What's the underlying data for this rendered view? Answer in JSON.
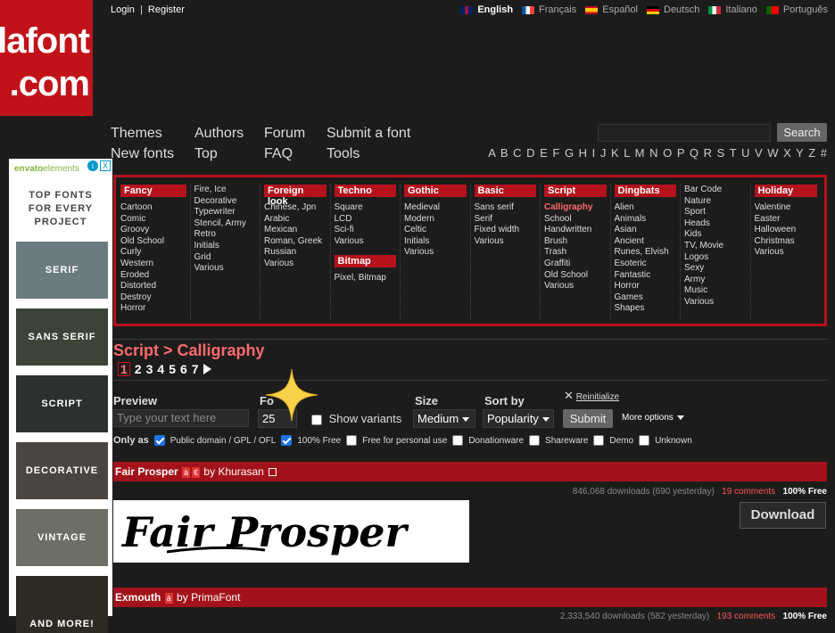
{
  "logo": {
    "line1": "lafont",
    "line2": ".com"
  },
  "topbar": {
    "login": "Login",
    "sep": "|",
    "register": "Register"
  },
  "languages": [
    {
      "label": "English",
      "active": true,
      "colors": [
        "#012169",
        "#c8102e"
      ]
    },
    {
      "label": "Français",
      "active": false,
      "colors": [
        "#0055a4",
        "#ef4135"
      ]
    },
    {
      "label": "Español",
      "active": false,
      "colors": [
        "#c60b1e",
        "#ffc400"
      ]
    },
    {
      "label": "Deutsch",
      "active": false,
      "colors": [
        "#000000",
        "#dd0000"
      ]
    },
    {
      "label": "Italiano",
      "active": false,
      "colors": [
        "#009246",
        "#ce2b37"
      ]
    },
    {
      "label": "Português",
      "active": false,
      "colors": [
        "#006600",
        "#ff0000"
      ]
    }
  ],
  "nav": {
    "themes": "Themes",
    "authors": "Authors",
    "forum": "Forum",
    "submit": "Submit a font",
    "new_fonts": "New fonts",
    "top": "Top",
    "faq": "FAQ",
    "tools": "Tools"
  },
  "search": {
    "button": "Search"
  },
  "alphabet": "A B C D E F G H I J K L M N O P Q R S T U V W X Y Z #",
  "ad": {
    "brand_a": "envato",
    "brand_b": "elements",
    "headline": "TOP FONTS FOR EVERY PROJECT",
    "tiles": [
      "SERIF",
      "SANS SERIF",
      "SCRIPT",
      "DECORATIVE",
      "VINTAGE",
      "AND MORE!"
    ],
    "info": "i",
    "close": "X"
  },
  "categories": [
    {
      "header": "Fancy",
      "items": [
        "Cartoon",
        "Comic",
        "Groovy",
        "Old School",
        "Curly",
        "Western",
        "Eroded",
        "Distorted",
        "Destroy",
        "Horror"
      ]
    },
    {
      "header": "",
      "items": [
        "Fire, Ice",
        "Decorative",
        "Typewriter",
        "Stencil, Army",
        "Retro",
        "Initials",
        "Grid",
        "Various"
      ]
    },
    {
      "header": "Foreign look",
      "items": [
        "Chinese, Jpn",
        "Arabic",
        "Mexican",
        "Roman, Greek",
        "Russian",
        "Various"
      ]
    },
    {
      "header": "Techno",
      "items": [
        "Square",
        "LCD",
        "Sci-fi",
        "Various"
      ],
      "header2": "Bitmap",
      "items2": [
        "Pixel, Bitmap"
      ]
    },
    {
      "header": "Gothic",
      "items": [
        "Medieval",
        "Modern",
        "Celtic",
        "Initials",
        "Various"
      ]
    },
    {
      "header": "Basic",
      "items": [
        "Sans serif",
        "Serif",
        "Fixed width",
        "Various"
      ]
    },
    {
      "header": "Script",
      "items": [
        "Calligraphy",
        "School",
        "Handwritten",
        "Brush",
        "Trash",
        "Graffiti",
        "Old School",
        "Various"
      ]
    },
    {
      "header": "Dingbats",
      "items": [
        "Alien",
        "Animals",
        "Asian",
        "Ancient",
        "Runes, Elvish",
        "Esoteric",
        "Fantastic",
        "Horror",
        "Games",
        "Shapes"
      ]
    },
    {
      "header": "",
      "items": [
        "Bar Code",
        "Nature",
        "Sport",
        "Heads",
        "Kids",
        "TV, Movie",
        "Logos",
        "Sexy",
        "Army",
        "Music",
        "Various"
      ]
    },
    {
      "header": "Holiday",
      "items": [
        "Valentine",
        "Easter",
        "Halloween",
        "Christmas",
        "Various"
      ]
    }
  ],
  "page_title": "Script > Calligraphy",
  "pagination": {
    "current": "1",
    "pages": [
      "2",
      "3",
      "4",
      "5",
      "6",
      "7"
    ]
  },
  "options": {
    "preview_label": "Preview",
    "preview_placeholder": "Type your text here",
    "font_size_label": "Fo",
    "font_size_value": "25",
    "show_variants": "Show variants",
    "size_label": "Size",
    "size_value": "Medium",
    "sort_label": "Sort by",
    "sort_value": "Popularity",
    "reinit_icon": "✕",
    "reinit": "Reinitialize",
    "submit": "Submit",
    "more": "More options"
  },
  "filters": {
    "label": "Only as",
    "items": [
      {
        "label": "Public domain / GPL / OFL",
        "checked": true
      },
      {
        "label": "100% Free",
        "checked": true
      },
      {
        "label": "Free for personal use",
        "checked": false
      },
      {
        "label": "Donationware",
        "checked": false
      },
      {
        "label": "Shareware",
        "checked": false
      },
      {
        "label": "Demo",
        "checked": false
      },
      {
        "label": "Unknown",
        "checked": false
      }
    ]
  },
  "fonts": [
    {
      "name": "Fair Prosper",
      "badges": [
        "à",
        "€"
      ],
      "by": "by",
      "author": "Khurasan",
      "downloads": "846,068 downloads (690 yesterday)",
      "comments": "19 comments",
      "license": "100% Free",
      "preview_text": "Fair Prosper",
      "download": "Download"
    },
    {
      "name": "Exmouth",
      "badges": [
        "à"
      ],
      "by": "by",
      "author": "PrimaFont",
      "downloads": "2,333,540 downloads (582 yesterday)",
      "comments": "193 comments",
      "license": "100% Free"
    }
  ]
}
